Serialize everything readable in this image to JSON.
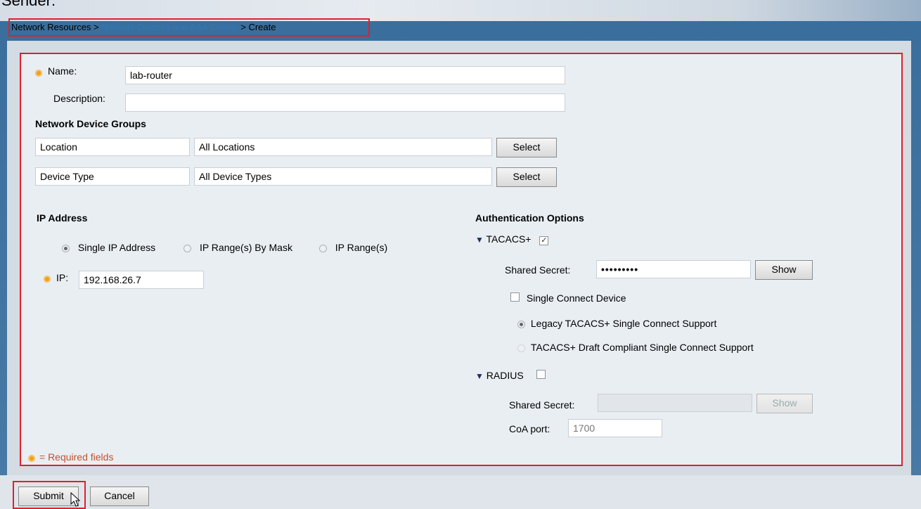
{
  "page_heading": "Sender:",
  "breadcrumb": {
    "item1": "Network Resources >",
    "item2": "Network Devices and AAA Clients",
    "item3": "> Create"
  },
  "form": {
    "name_label": "Name:",
    "name_value": "lab-router",
    "description_label": "Description:",
    "description_value": "",
    "ndg_heading": "Network Device Groups",
    "ndg_rows": [
      {
        "label": "Location",
        "value": "All Locations",
        "button": "Select"
      },
      {
        "label": "Device Type",
        "value": "All Device Types",
        "button": "Select"
      }
    ],
    "ip_heading": "IP Address",
    "ip_options": [
      "Single IP Address",
      "IP Range(s) By Mask",
      "IP Range(s)"
    ],
    "ip_selected": "Single IP Address",
    "ip_label": "IP:",
    "ip_value": "192.168.26.7",
    "auth_heading": "Authentication Options",
    "tacacs": {
      "label": "TACACS+",
      "checked": true,
      "check_glyph": "✓",
      "shared_secret_label": "Shared Secret:",
      "shared_secret_value": "•••••••••",
      "show_button": "Show",
      "single_connect_label": "Single Connect Device",
      "single_connect_checked": false,
      "legacy_label": "Legacy TACACS+ Single Connect Support",
      "draft_label": "TACACS+ Draft Compliant Single Connect Support"
    },
    "radius": {
      "label": "RADIUS",
      "checked": false,
      "shared_secret_label": "Shared Secret:",
      "shared_secret_value": "",
      "show_button": "Show",
      "coa_label": "CoA port:",
      "coa_value": "1700"
    },
    "required_note": "= Required fields"
  },
  "buttons": {
    "submit": "Submit",
    "cancel": "Cancel"
  },
  "colors": {
    "highlight_border": "#e0202c",
    "required_icon": "#f0a020",
    "link": "#2f78b8"
  }
}
